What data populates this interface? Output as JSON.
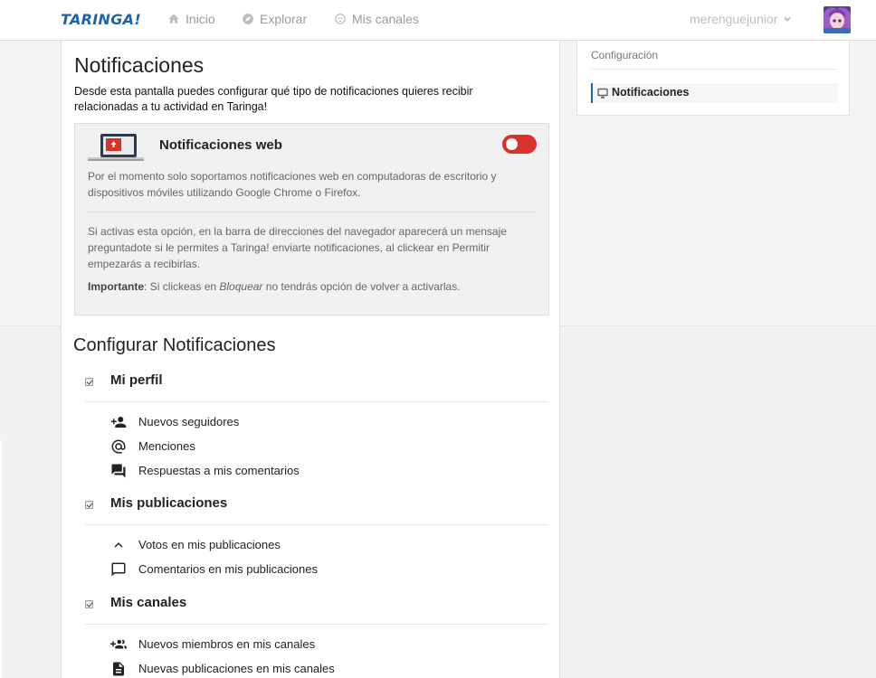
{
  "header": {
    "logo": "TARINGA!",
    "nav": [
      {
        "label": "Inicio",
        "icon": "home-icon"
      },
      {
        "label": "Explorar",
        "icon": "compass-icon"
      },
      {
        "label": "Mis canales",
        "icon": "channels-icon"
      }
    ],
    "username": "merenguejunior"
  },
  "notifications": {
    "title": "Notificaciones",
    "description": "Desde esta pantalla puedes configurar qué tipo de notificaciones quieres recibir relacionadas a tu actividad en Taringa!",
    "web": {
      "title": "Notificaciones web",
      "toggle_on": true,
      "toggle_color": "#d9312b",
      "p1": "Por el momento solo soportamos notificaciones web en computadoras de escritorio y dispositivos móviles utilizando Google Chrome o Firefox.",
      "p2": "Si activas esta opción, en la barra de direcciones del navegador aparecerá un mensaje preguntadote si le permites a Taringa! enviarte notificaciones, al clickear en Permitir empezarás a recibirlas.",
      "p3_strong": "Importante",
      "p3_a": ": Si clickeas en ",
      "p3_em": "Bloquear",
      "p3_b": " no tendrás opción de volver a activarlas."
    }
  },
  "config": {
    "title": "Configurar Notificaciones",
    "sections": [
      {
        "label": "Mi perfil",
        "checked": true,
        "items": [
          {
            "label": "Nuevos seguidores",
            "icon": "person-add-icon"
          },
          {
            "label": "Menciones",
            "icon": "at-icon"
          },
          {
            "label": "Respuestas a mis comentarios",
            "icon": "forum-icon"
          }
        ]
      },
      {
        "label": "Mis publicaciones",
        "checked": true,
        "items": [
          {
            "label": "Votos en mis publicaciones",
            "icon": "chevron-up-icon"
          },
          {
            "label": "Comentarios en mis publicaciones",
            "icon": "comment-icon"
          }
        ]
      },
      {
        "label": "Mis canales",
        "checked": true,
        "items": [
          {
            "label": "Nuevos miembros en mis canales",
            "icon": "group-add-icon"
          },
          {
            "label": "Nuevas publicaciones en mis canales",
            "icon": "document-icon"
          }
        ]
      }
    ]
  },
  "sidebar": {
    "title": "Configuración",
    "items": [
      {
        "label": "Notificaciones",
        "icon": "monitor-icon",
        "active": true
      }
    ]
  },
  "colors": {
    "brand": "#1f62a8",
    "toggle": "#d9312b"
  }
}
